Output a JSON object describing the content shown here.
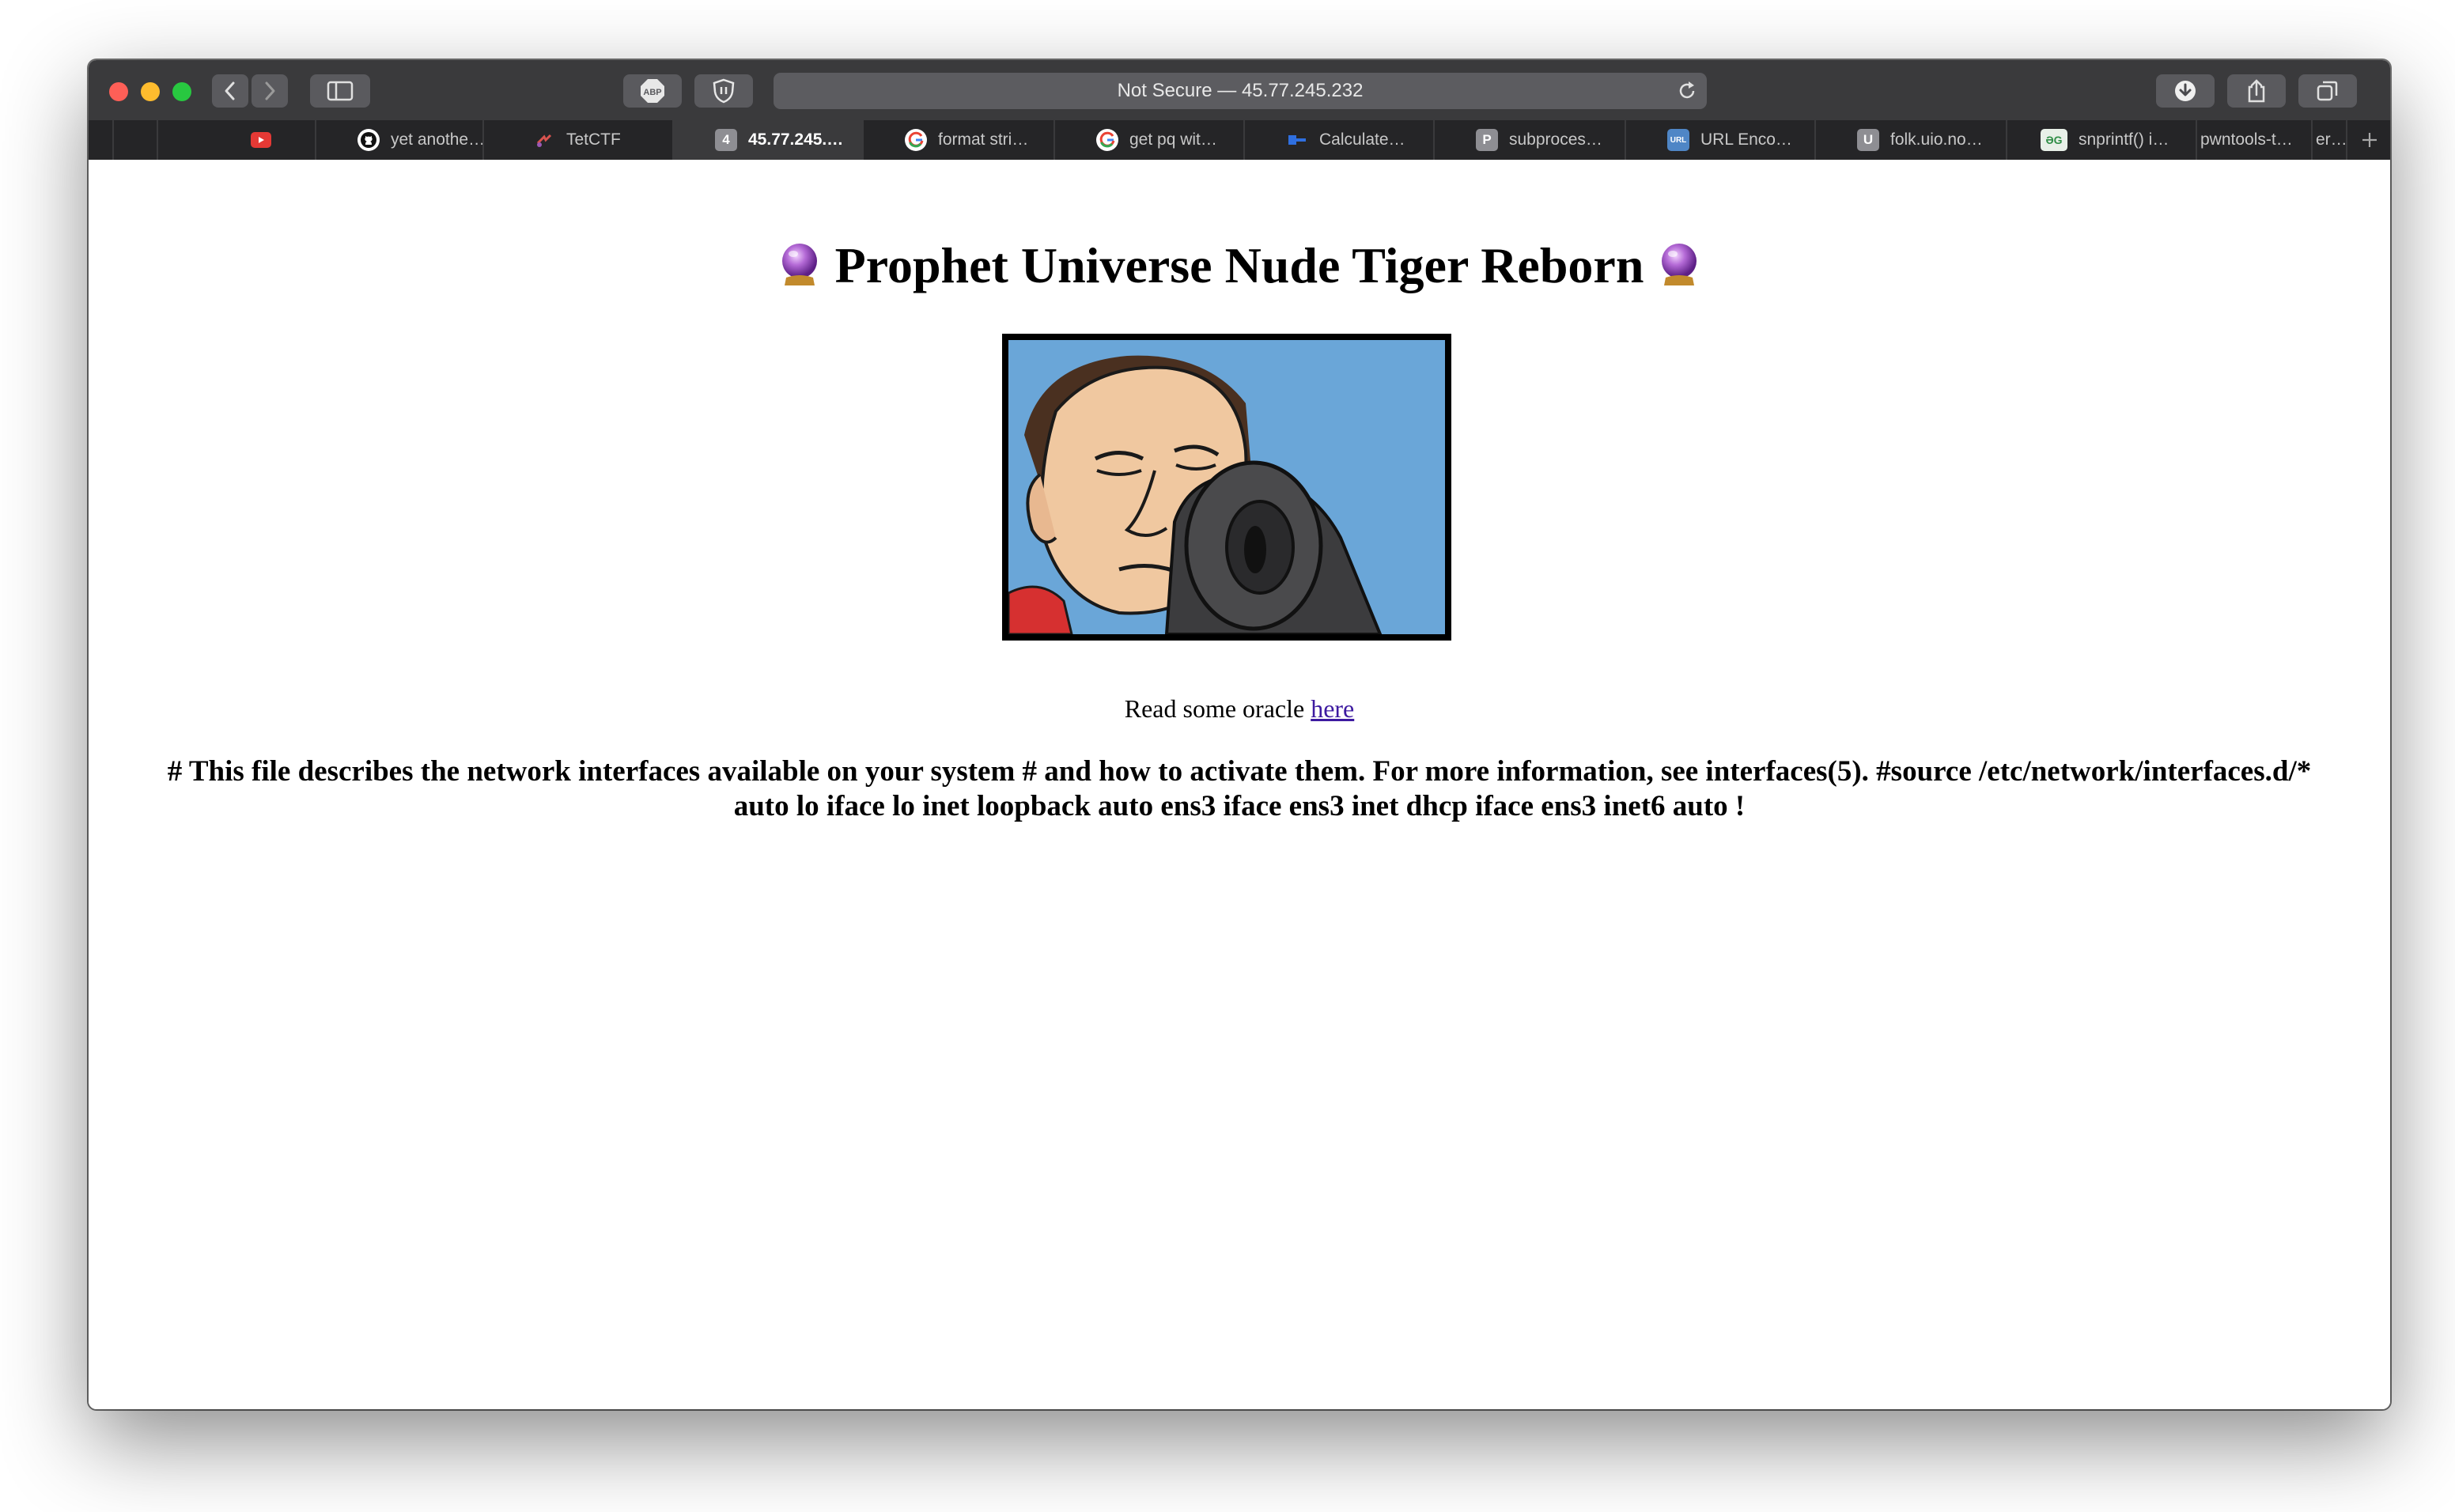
{
  "browser": {
    "address": "Not Secure — 45.77.245.232",
    "tabs": [
      {
        "label": "",
        "icon": "youtube-icon",
        "color": "#e53935"
      },
      {
        "label": "yet anothe…",
        "icon": "github-icon",
        "color": "#ffffff"
      },
      {
        "label": "TetCTF",
        "icon": "tetctf-icon",
        "color": "#d9534f"
      },
      {
        "label": "45.77.245.…",
        "icon": "number-badge-icon",
        "badge": "4",
        "active": true
      },
      {
        "label": "format stri…",
        "icon": "google-icon"
      },
      {
        "label": "get pq wit…",
        "icon": "google-icon"
      },
      {
        "label": "Calculate…",
        "icon": "calculator-icon",
        "color": "#2f6fe0"
      },
      {
        "label": "subproces…",
        "icon": "letter-icon",
        "badge": "P"
      },
      {
        "label": "URL Enco…",
        "icon": "url-icon",
        "badge": "URL"
      },
      {
        "label": "folk.uio.no…",
        "icon": "letter-icon",
        "badge": "U"
      },
      {
        "label": "snprintf() i…",
        "icon": "geeksforgeeks-icon",
        "badge": "ƏG"
      },
      {
        "label": "pwntools-t…",
        "icon": ""
      },
      {
        "label": "er…",
        "icon": ""
      }
    ]
  },
  "page": {
    "title": "Prophet Universe Nude Tiger Reborn",
    "oracle_text": "Read some oracle ",
    "oracle_link": "here",
    "file_line1": "# This file describes the network interfaces available on your system # and how to activate them. For more information, see interfaces(5). #source /etc/network/interfaces.d/*",
    "file_line2": "auto lo iface lo inet loopback auto ens3 iface ens3 inet dhcp iface ens3 inet6 auto !"
  }
}
